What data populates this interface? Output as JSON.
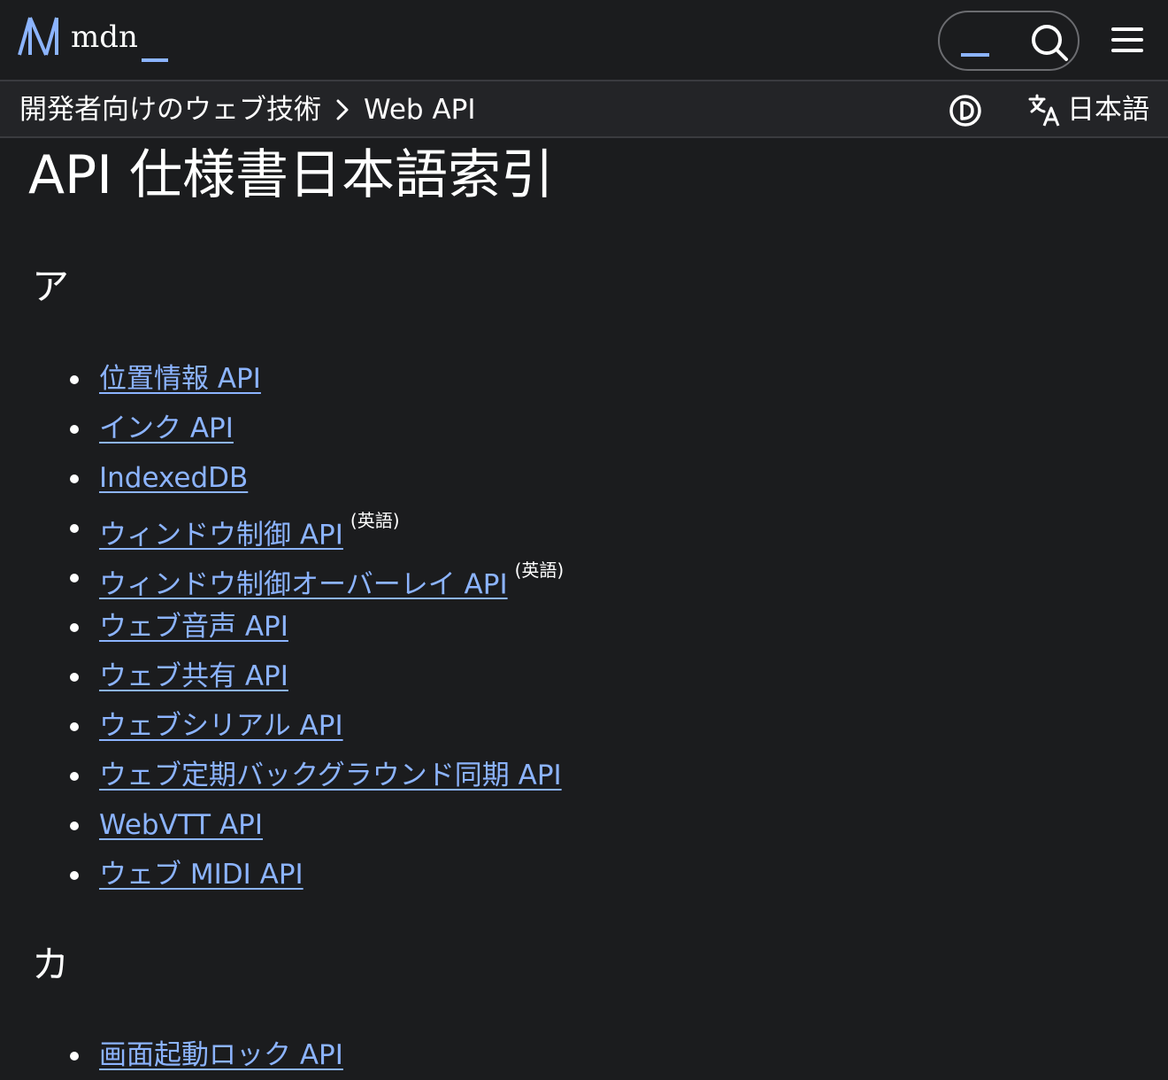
{
  "header": {
    "logo_text": "mdn",
    "search_label": "検索",
    "menu_label": "メニュー"
  },
  "breadcrumb": {
    "items": [
      {
        "label": "開発者向けのウェブ技術"
      },
      {
        "label": "Web API"
      }
    ],
    "theme_label": "テーマ",
    "language_label": "日本語"
  },
  "page": {
    "title": "API 仕様書日本語索引"
  },
  "sections": [
    {
      "heading": "ア",
      "items": [
        {
          "label": "位置情報 API",
          "note": ""
        },
        {
          "label": "インク API",
          "note": ""
        },
        {
          "label": "IndexedDB",
          "note": ""
        },
        {
          "label": "ウィンドウ制御 API",
          "note": "(英語)"
        },
        {
          "label": "ウィンドウ制御オーバーレイ API",
          "note": "(英語)"
        },
        {
          "label": "ウェブ音声 API",
          "note": ""
        },
        {
          "label": "ウェブ共有 API",
          "note": ""
        },
        {
          "label": "ウェブシリアル API",
          "note": ""
        },
        {
          "label": "ウェブ定期バックグラウンド同期 API",
          "note": ""
        },
        {
          "label": "WebVTT API",
          "note": ""
        },
        {
          "label": "ウェブ MIDI API",
          "note": ""
        }
      ]
    },
    {
      "heading": "カ",
      "items": [
        {
          "label": "画面起動ロック API",
          "note": ""
        }
      ]
    }
  ],
  "colors": {
    "background": "#1b1c1e",
    "link": "#8cb4ff",
    "text": "#ffffff"
  }
}
